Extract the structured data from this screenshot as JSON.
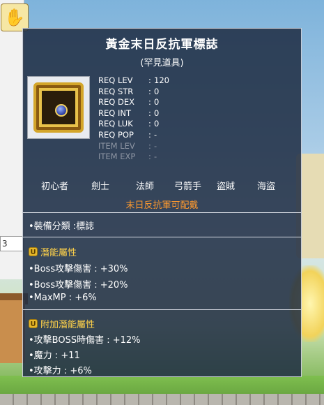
{
  "icon": {
    "name": "glove-icon",
    "glyph": "✋"
  },
  "background": {
    "field_value": "3"
  },
  "tooltip": {
    "title": "黃金末日反抗軍標誌",
    "subtitle": "(罕見道具)",
    "item_icon": "emblem-icon",
    "requirements": [
      {
        "label": "REQ LEV",
        "value": "120",
        "met": true
      },
      {
        "label": "REQ STR",
        "value": "0",
        "met": true
      },
      {
        "label": "REQ DEX",
        "value": "0",
        "met": true
      },
      {
        "label": "REQ INT",
        "value": "0",
        "met": true
      },
      {
        "label": "REQ LUK",
        "value": "0",
        "met": true
      },
      {
        "label": "REQ POP",
        "value": "-",
        "met": true
      },
      {
        "label": "ITEM LEV",
        "value": "-",
        "met": false
      },
      {
        "label": "ITEM EXP",
        "value": "-",
        "met": false
      }
    ],
    "jobs": [
      "初心者",
      "劍士",
      "法師",
      "弓箭手",
      "盜賊",
      "海盜"
    ],
    "faction_note": "末日反抗軍可配戴",
    "category": "•裝備分類 :標誌",
    "potential": {
      "header": "潛能屬性",
      "lines": [
        "•Boss攻擊傷害 : +30%",
        "•Boss攻擊傷害 : +20%",
        "•MaxMP : +6%"
      ]
    },
    "bonus_potential": {
      "header": "附加潛能屬性",
      "lines": [
        "•攻擊BOSS時傷害 : +12%",
        "•魔力 : +11",
        "•攻擊力 : +6%"
      ]
    }
  },
  "colors": {
    "accent_orange": "#ff9a2e",
    "potential_gold": "#ffd24a",
    "panel_bg": "#1e2c42"
  }
}
